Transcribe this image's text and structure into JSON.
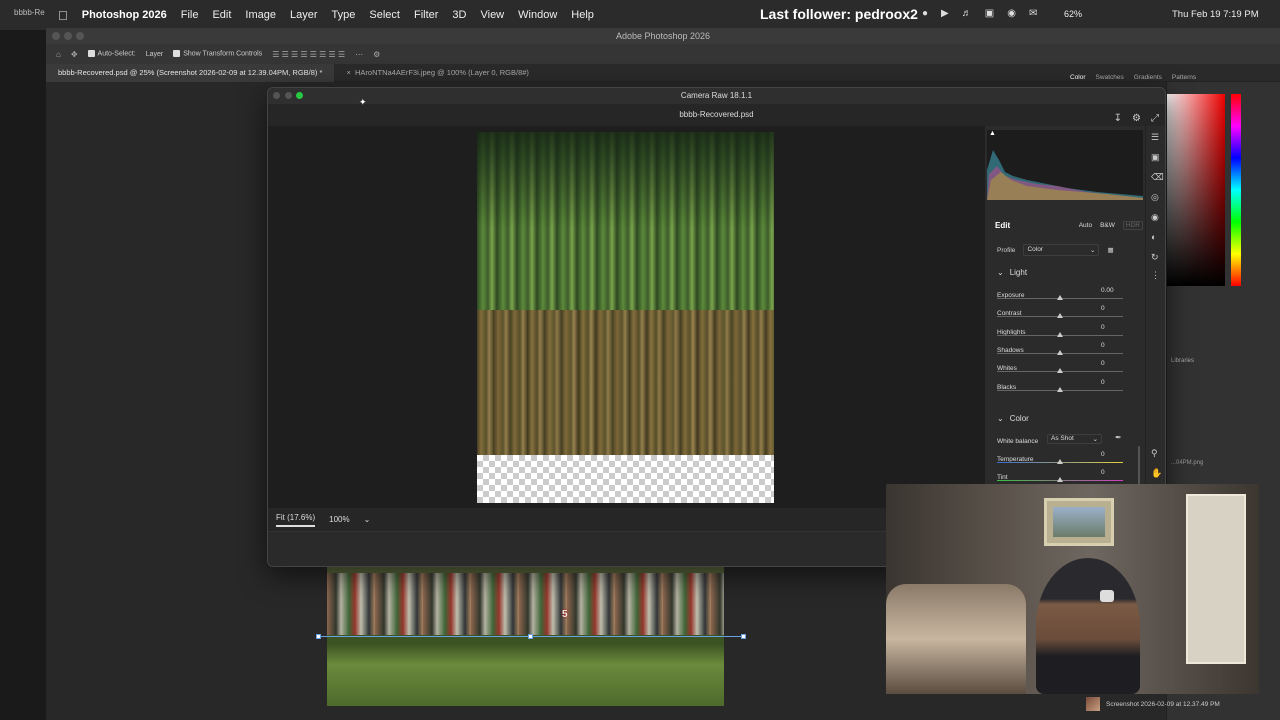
{
  "menubar": {
    "left_tab": "bbbb-Re",
    "app": "Photoshop 2026",
    "items": [
      "File",
      "Edit",
      "Image",
      "Layer",
      "Type",
      "Select",
      "Filter",
      "3D",
      "View",
      "Window",
      "Help"
    ],
    "stream_title": "Last follower: pedroox2",
    "battery": "62%",
    "clock": "Thu Feb 19  7:19 PM"
  },
  "ps": {
    "window_title": "Adobe Photoshop 2026",
    "options": {
      "auto_select": "Auto-Select:",
      "layer": "Layer",
      "show_transform": "Show Transform Controls"
    },
    "tabs": [
      {
        "label": "bbbb-Recovered.psd @ 25% (Screenshot 2026-02-09 at 12.39.04PM, RGB/8) *"
      },
      {
        "label": "HAroNTNa4AErF3i.jpeg @ 100% (Layer 0, RGB/8#)"
      }
    ],
    "right_panel": {
      "tabs": [
        "Color",
        "Swatches",
        "Gradients",
        "Patterns"
      ],
      "libraries": "Libraries",
      "file": "...04PM.png"
    }
  },
  "camera_raw": {
    "title": "Camera Raw 18.1.1",
    "filename": "bbbb-Recovered.psd",
    "zoom_fit": "Fit (17.6%)",
    "zoom_100": "100%",
    "edit": {
      "title": "Edit",
      "auto": "Auto",
      "bw": "B&W",
      "hdr": "HDR",
      "profile_label": "Profile",
      "profile_value": "Color"
    },
    "light": {
      "title": "Light",
      "sliders": [
        {
          "label": "Exposure",
          "value": "0.00"
        },
        {
          "label": "Contrast",
          "value": "0"
        },
        {
          "label": "Highlights",
          "value": "0"
        },
        {
          "label": "Shadows",
          "value": "0"
        },
        {
          "label": "Whites",
          "value": "0"
        },
        {
          "label": "Blacks",
          "value": "0"
        }
      ]
    },
    "color": {
      "title": "Color",
      "wb_label": "White balance",
      "wb_value": "As Shot",
      "sliders": [
        {
          "label": "Temperature",
          "value": "0"
        },
        {
          "label": "Tint",
          "value": "0"
        }
      ]
    }
  },
  "canvas": {
    "jersey_number": "5"
  },
  "desktop": {
    "screenshot_label": "Screenshot 2026-02-09 at 12.37.49 PM"
  },
  "colors": {
    "accent_green": "#28c840",
    "selection_blue": "#6aa0e0"
  }
}
